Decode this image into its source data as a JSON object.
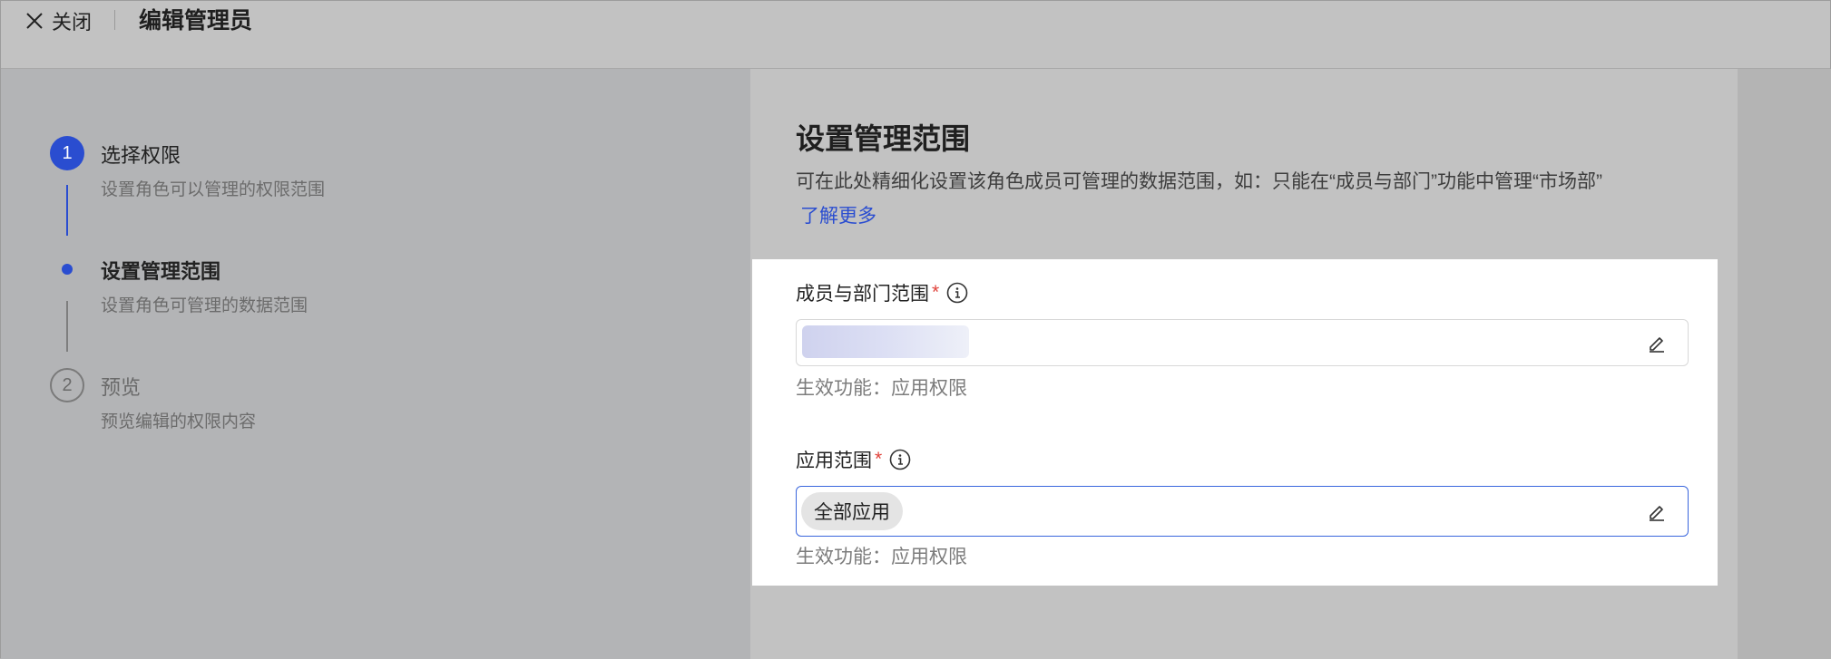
{
  "header": {
    "close_label": "关闭",
    "title": "编辑管理员"
  },
  "steps": [
    {
      "number": "1",
      "title": "选择权限",
      "description": "设置角色可以管理的权限范围",
      "state": "completed"
    },
    {
      "number": "",
      "title": "设置管理范围",
      "description": "设置角色可管理的数据范围",
      "state": "current"
    },
    {
      "number": "2",
      "title": "预览",
      "description": "预览编辑的权限内容",
      "state": "pending"
    }
  ],
  "main": {
    "title": "设置管理范围",
    "description": "可在此处精细化设置该角色成员可管理的数据范围，如：只能在“成员与部门”功能中管理“市场部”",
    "learn_more": "了解更多",
    "fields": [
      {
        "label": "成员与部门范围",
        "required_mark": "*",
        "value": "",
        "note": "生效功能：应用权限"
      },
      {
        "label": "应用范围",
        "required_mark": "*",
        "value": "全部应用",
        "note": "生效功能：应用权限"
      }
    ]
  },
  "colors": {
    "accent": "#2a4dd0",
    "required": "#e0423a",
    "overlay_bg": "#c2c2c2"
  },
  "icons": [
    "close-icon",
    "info-icon",
    "edit-pencil-icon"
  ]
}
